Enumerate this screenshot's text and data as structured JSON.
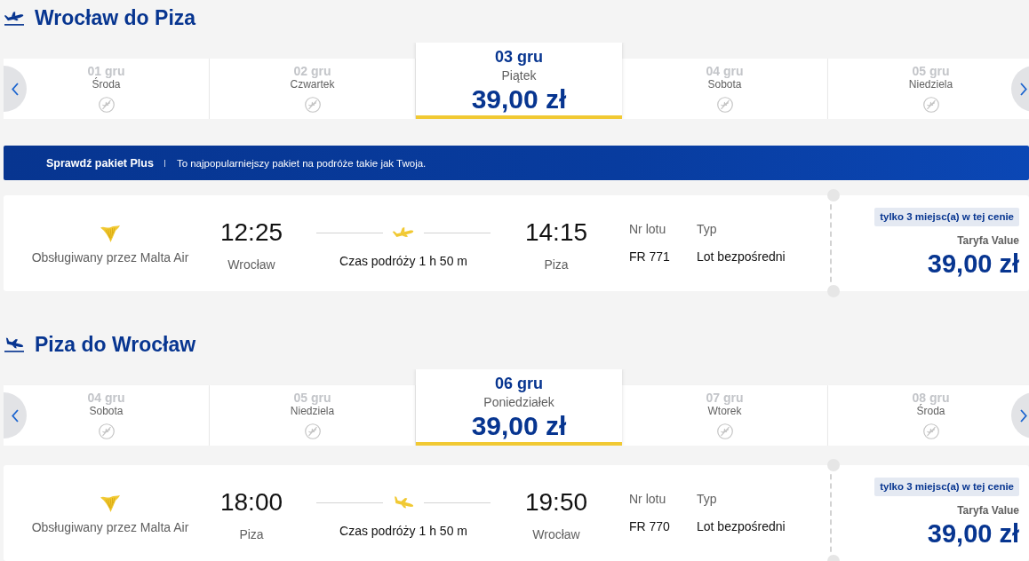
{
  "sections": [
    {
      "kind": "outbound",
      "title": "Wrocław do Piza",
      "dates": [
        {
          "date": "01 gru",
          "day": "Środa",
          "available": false,
          "selected": false
        },
        {
          "date": "02 gru",
          "day": "Czwartek",
          "available": false,
          "selected": false
        },
        {
          "date": "03 gru",
          "day": "Piątek",
          "available": true,
          "price": "39,00 zł",
          "selected": true
        },
        {
          "date": "04 gru",
          "day": "Sobota",
          "available": false,
          "selected": false
        },
        {
          "date": "05 gru",
          "day": "Niedziela",
          "available": false,
          "selected": false
        }
      ],
      "promo_banner": {
        "title": "Sprawdź pakiet Plus",
        "text": "To najpopularniejszy pakiet na podróże takie jak Twoja."
      },
      "flight": {
        "operator": "Obsługiwany przez Malta Air",
        "departure_time": "12:25",
        "departure_city": "Wrocław",
        "duration": "Czas podróży 1 h 50 m",
        "arrival_time": "14:15",
        "arrival_city": "Piza",
        "flight_number_label": "Nr lotu",
        "flight_number": "FR 771",
        "type_label": "Typ",
        "type": "Lot bezpośredni",
        "seats_badge": "tylko 3 miejsc(a) w tej cenie",
        "fare": "Taryfa Value",
        "price": "39,00 zł"
      }
    },
    {
      "kind": "inbound",
      "title": "Piza do Wrocław",
      "dates": [
        {
          "date": "04 gru",
          "day": "Sobota",
          "available": false,
          "selected": false
        },
        {
          "date": "05 gru",
          "day": "Niedziela",
          "available": false,
          "selected": false
        },
        {
          "date": "06 gru",
          "day": "Poniedziałek",
          "available": true,
          "price": "39,00 zł",
          "selected": true
        },
        {
          "date": "07 gru",
          "day": "Wtorek",
          "available": false,
          "selected": false
        },
        {
          "date": "08 gru",
          "day": "Środa",
          "available": false,
          "selected": false
        }
      ],
      "flight": {
        "operator": "Obsługiwany przez Malta Air",
        "departure_time": "18:00",
        "departure_city": "Piza",
        "duration": "Czas podróży 1 h 50 m",
        "arrival_time": "19:50",
        "arrival_city": "Wrocław",
        "flight_number_label": "Nr lotu",
        "flight_number": "FR 770",
        "type_label": "Typ",
        "type": "Lot bezpośredni",
        "seats_badge": "tylko 3 miejsc(a) w tej cenie",
        "fare": "Taryfa Value",
        "price": "39,00 zł"
      }
    }
  ]
}
